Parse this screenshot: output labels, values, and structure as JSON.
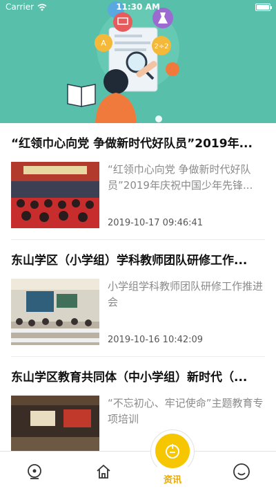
{
  "status_bar": {
    "carrier": "Carrier",
    "time": "11:30 AM",
    "icons": [
      "wifi-icon",
      "battery-icon"
    ]
  },
  "banner": {
    "illustration": "person-reading-with-magnifier",
    "badges": [
      "A",
      "B",
      "2÷2",
      "book",
      "laptop",
      "flask"
    ],
    "accent_colors": [
      "#58c0aa",
      "#f26b3a",
      "#6ec1ea",
      "#f4b93a",
      "#e65b5b"
    ]
  },
  "articles": [
    {
      "title": "“红领巾心向党 争做新时代好队员”2019年...",
      "summary": "“红领巾心向党 争做新时代好队员”2019年庆祝中国少年先锋...",
      "time": "2019-10-17 09:46:41",
      "thumbnail": "auditorium-students-red-uniforms"
    },
    {
      "title": "东山学区（小学组）学科教师团队研修工作...",
      "summary": "小学组学科教师团队研修工作推进会",
      "time": "2019-10-16 10:42:09",
      "thumbnail": "classroom-meeting-projector"
    },
    {
      "title": "东山学区教育共同体（中小学组）新时代（...",
      "summary": "“不忘初心、牢记使命”主题教育专项培训",
      "time": "",
      "thumbnail": "hall-stage-training"
    }
  ],
  "tabbar": {
    "tabs": [
      {
        "icon": "location-icon",
        "label": ""
      },
      {
        "icon": "home-icon",
        "label": ""
      },
      {
        "icon": "news-icon",
        "label": "资讯",
        "active": true
      },
      {
        "icon": "smile-icon",
        "label": ""
      }
    ],
    "active_color": "#f6c600"
  }
}
